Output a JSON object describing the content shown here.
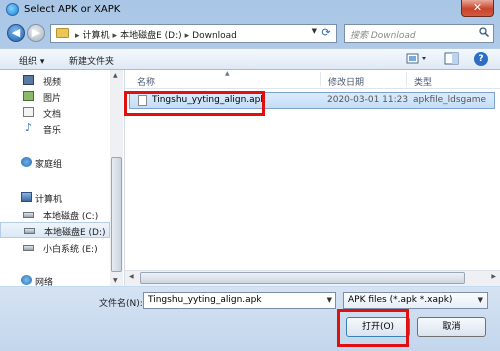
{
  "window": {
    "title": "Select APK or XAPK",
    "close_label": "✕"
  },
  "address_bar": {
    "crumbs": [
      "计算机",
      "本地磁盘E (D:)",
      "Download"
    ],
    "separator": "▸"
  },
  "search": {
    "placeholder": "搜索 Download"
  },
  "toolbar": {
    "organize_label": "组织 ▾",
    "new_folder_label": "新建文件夹",
    "help_label": "?"
  },
  "sidebar": {
    "items": [
      {
        "label": "视频",
        "icon": "video-icon"
      },
      {
        "label": "图片",
        "icon": "picture-icon"
      },
      {
        "label": "文档",
        "icon": "document-icon"
      },
      {
        "label": "音乐",
        "icon": "music-icon"
      },
      {
        "label": "家庭组",
        "icon": "homegroup-icon"
      },
      {
        "label": "计算机",
        "icon": "computer-icon"
      },
      {
        "label": "本地磁盘 (C:)",
        "icon": "drive-icon"
      },
      {
        "label": "本地磁盘E (D:)",
        "icon": "drive-icon",
        "selected": true
      },
      {
        "label": "小白系统 (E:)",
        "icon": "drive-icon"
      },
      {
        "label": "网络",
        "icon": "network-icon"
      }
    ]
  },
  "file_list": {
    "columns": {
      "name": "名称",
      "date": "修改日期",
      "type": "类型"
    },
    "rows": [
      {
        "name": "Tingshu_yyting_align.apk",
        "date": "2020-03-01 11:23",
        "type": "apkfile_ldsgame"
      }
    ]
  },
  "bottom": {
    "file_name_label": "文件名(N):",
    "file_name_value": "Tingshu_yyting_align.apk",
    "filter_value": "APK files (*.apk *.xapk)",
    "open_label": "打开(O)",
    "cancel_label": "取消"
  },
  "colors": {
    "highlight": "#e01010",
    "accent": "#2a6ec6"
  }
}
